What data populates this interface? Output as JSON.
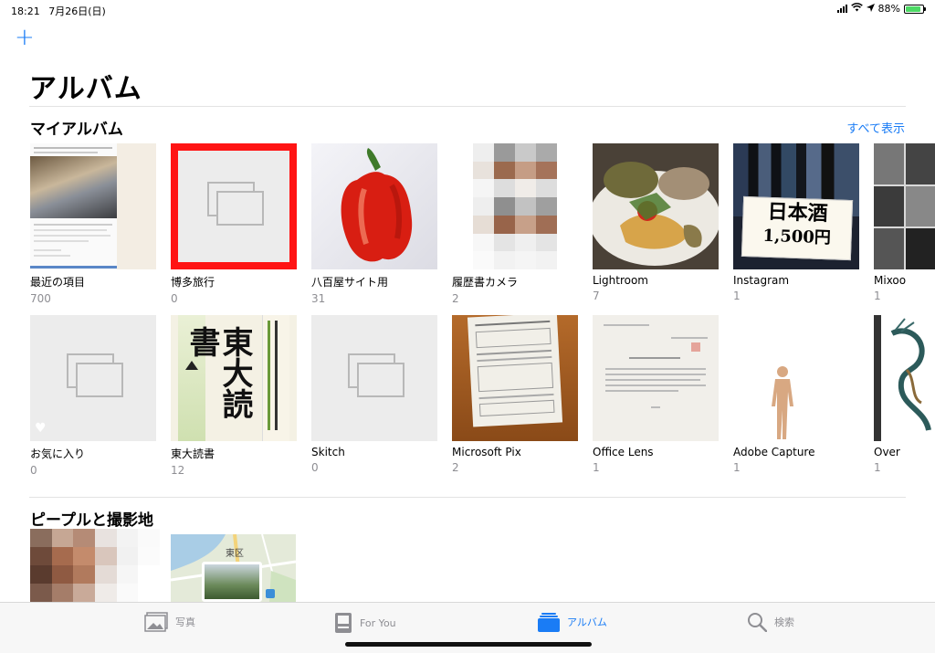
{
  "status_bar": {
    "time": "18:21",
    "date": "7月26日(日)",
    "battery": "88%"
  },
  "header": {
    "title": "アルバム",
    "add_label": "+"
  },
  "my_albums": {
    "title": "マイアルバム",
    "see_all": "すべて表示",
    "row1": [
      {
        "name": "最近の項目",
        "count": "700"
      },
      {
        "name": "博多旅行",
        "count": "0"
      },
      {
        "name": "八百屋サイト用",
        "count": "31"
      },
      {
        "name": "履歴書カメラ",
        "count": "2"
      },
      {
        "name": "Lightroom",
        "count": "7"
      },
      {
        "name": "Instagram",
        "count": "1"
      },
      {
        "name": "Mixoo",
        "count": "1"
      }
    ],
    "row2": [
      {
        "name": "お気に入り",
        "count": "0"
      },
      {
        "name": "東大読書",
        "count": "12"
      },
      {
        "name": "Skitch",
        "count": "0"
      },
      {
        "name": "Microsoft Pix",
        "count": "2"
      },
      {
        "name": "Office Lens",
        "count": "1"
      },
      {
        "name": "Adobe Capture",
        "count": "1"
      },
      {
        "name": "Over",
        "count": "1"
      }
    ]
  },
  "book_cover": {
    "title": "東大読書"
  },
  "sake_sign": {
    "main": "日本酒",
    "price": "1,500円"
  },
  "people_places": {
    "title": "ピープルと撮影地",
    "map_label": "東区"
  },
  "tab_bar": {
    "tabs": [
      {
        "label": "写真"
      },
      {
        "label": "For You"
      },
      {
        "label": "アルバム"
      },
      {
        "label": "検索"
      }
    ]
  },
  "colors": {
    "accent": "#1a7cf5",
    "selection": "#ff1414"
  }
}
